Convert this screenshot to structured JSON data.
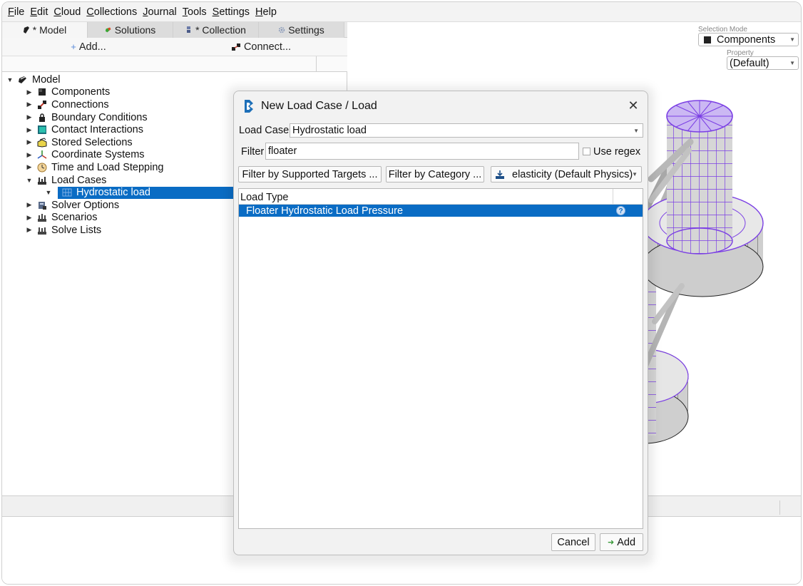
{
  "menu": [
    {
      "pre": "",
      "u": "F",
      "post": "ile"
    },
    {
      "pre": "",
      "u": "E",
      "post": "dit"
    },
    {
      "pre": "",
      "u": "C",
      "post": "loud"
    },
    {
      "pre": "",
      "u": "C",
      "post": "ollections"
    },
    {
      "pre": "",
      "u": "J",
      "post": "ournal"
    },
    {
      "pre": "",
      "u": "T",
      "post": "ools"
    },
    {
      "pre": "",
      "u": "S",
      "post": "ettings"
    },
    {
      "pre": "",
      "u": "H",
      "post": "elp"
    }
  ],
  "tabs": {
    "model": "* Model",
    "solutions": "Solutions",
    "collection": "* Collection",
    "settings": "Settings"
  },
  "toolbar": {
    "add": "Add...",
    "connect": "Connect..."
  },
  "tree": {
    "root": "Model",
    "components": "Components",
    "connections": "Connections",
    "boundary": "Boundary Conditions",
    "contact": "Contact Interactions",
    "stored": "Stored Selections",
    "coords": "Coordinate Systems",
    "time": "Time and Load Stepping",
    "loadcases": "Load Cases",
    "hydrostatic": "Hydrostatic load",
    "solver": "Solver Options",
    "scenarios": "Scenarios",
    "solve_lists": "Solve Lists"
  },
  "viewport": {
    "selection_mode_label": "Selection Mode",
    "selection_mode_value": "Components",
    "property_label": "Property",
    "property_value": "(Default)"
  },
  "dialog": {
    "title": "New Load Case / Load",
    "load_case_label": "Load Case",
    "load_case_value": "Hydrostatic load",
    "filter_label": "Filter",
    "filter_value": "floater",
    "use_regex": "Use regex",
    "filter_targets": "Filter by Supported Targets ...",
    "filter_category": "Filter by Category ...",
    "physics": "elasticity (Default Physics)",
    "list_header": "Load Type",
    "list_item": "Floater Hydrostatic Load Pressure",
    "cancel": "Cancel",
    "add": "Add"
  },
  "colors": {
    "selection": "#0a6cc4",
    "mesh": "#7b3fe4"
  }
}
